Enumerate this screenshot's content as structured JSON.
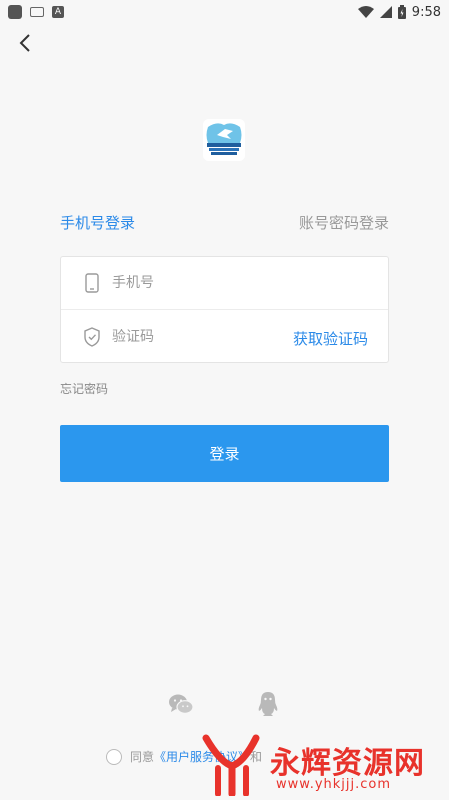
{
  "status_bar": {
    "time": "9:58",
    "icons": [
      "app-icon",
      "keyboard-icon",
      "a-icon",
      "wifi-icon",
      "signal-icon",
      "battery-icon"
    ]
  },
  "navigation": {
    "back_icon": "chevron-left-icon"
  },
  "tabs": {
    "phone_login": "手机号登录",
    "account_login": "账号密码登录",
    "active": "phone_login"
  },
  "form": {
    "phone": {
      "placeholder": "手机号",
      "value": ""
    },
    "code": {
      "placeholder": "验证码",
      "value": ""
    },
    "get_code_label": "获取验证码",
    "forgot_password": "忘记密码",
    "login_label": "登录"
  },
  "social": [
    "wechat-icon",
    "qq-icon"
  ],
  "agreement": {
    "prefix": "同意",
    "link": "《用户服务协议》",
    "joiner": "和"
  },
  "watermark": {
    "cn": "永辉资源网",
    "url": "www.yhkjjj.com"
  },
  "colors": {
    "accent": "#2b8ae8",
    "button": "#2b97ee",
    "background": "#f7f7f7",
    "watermark": "#e8322b"
  }
}
